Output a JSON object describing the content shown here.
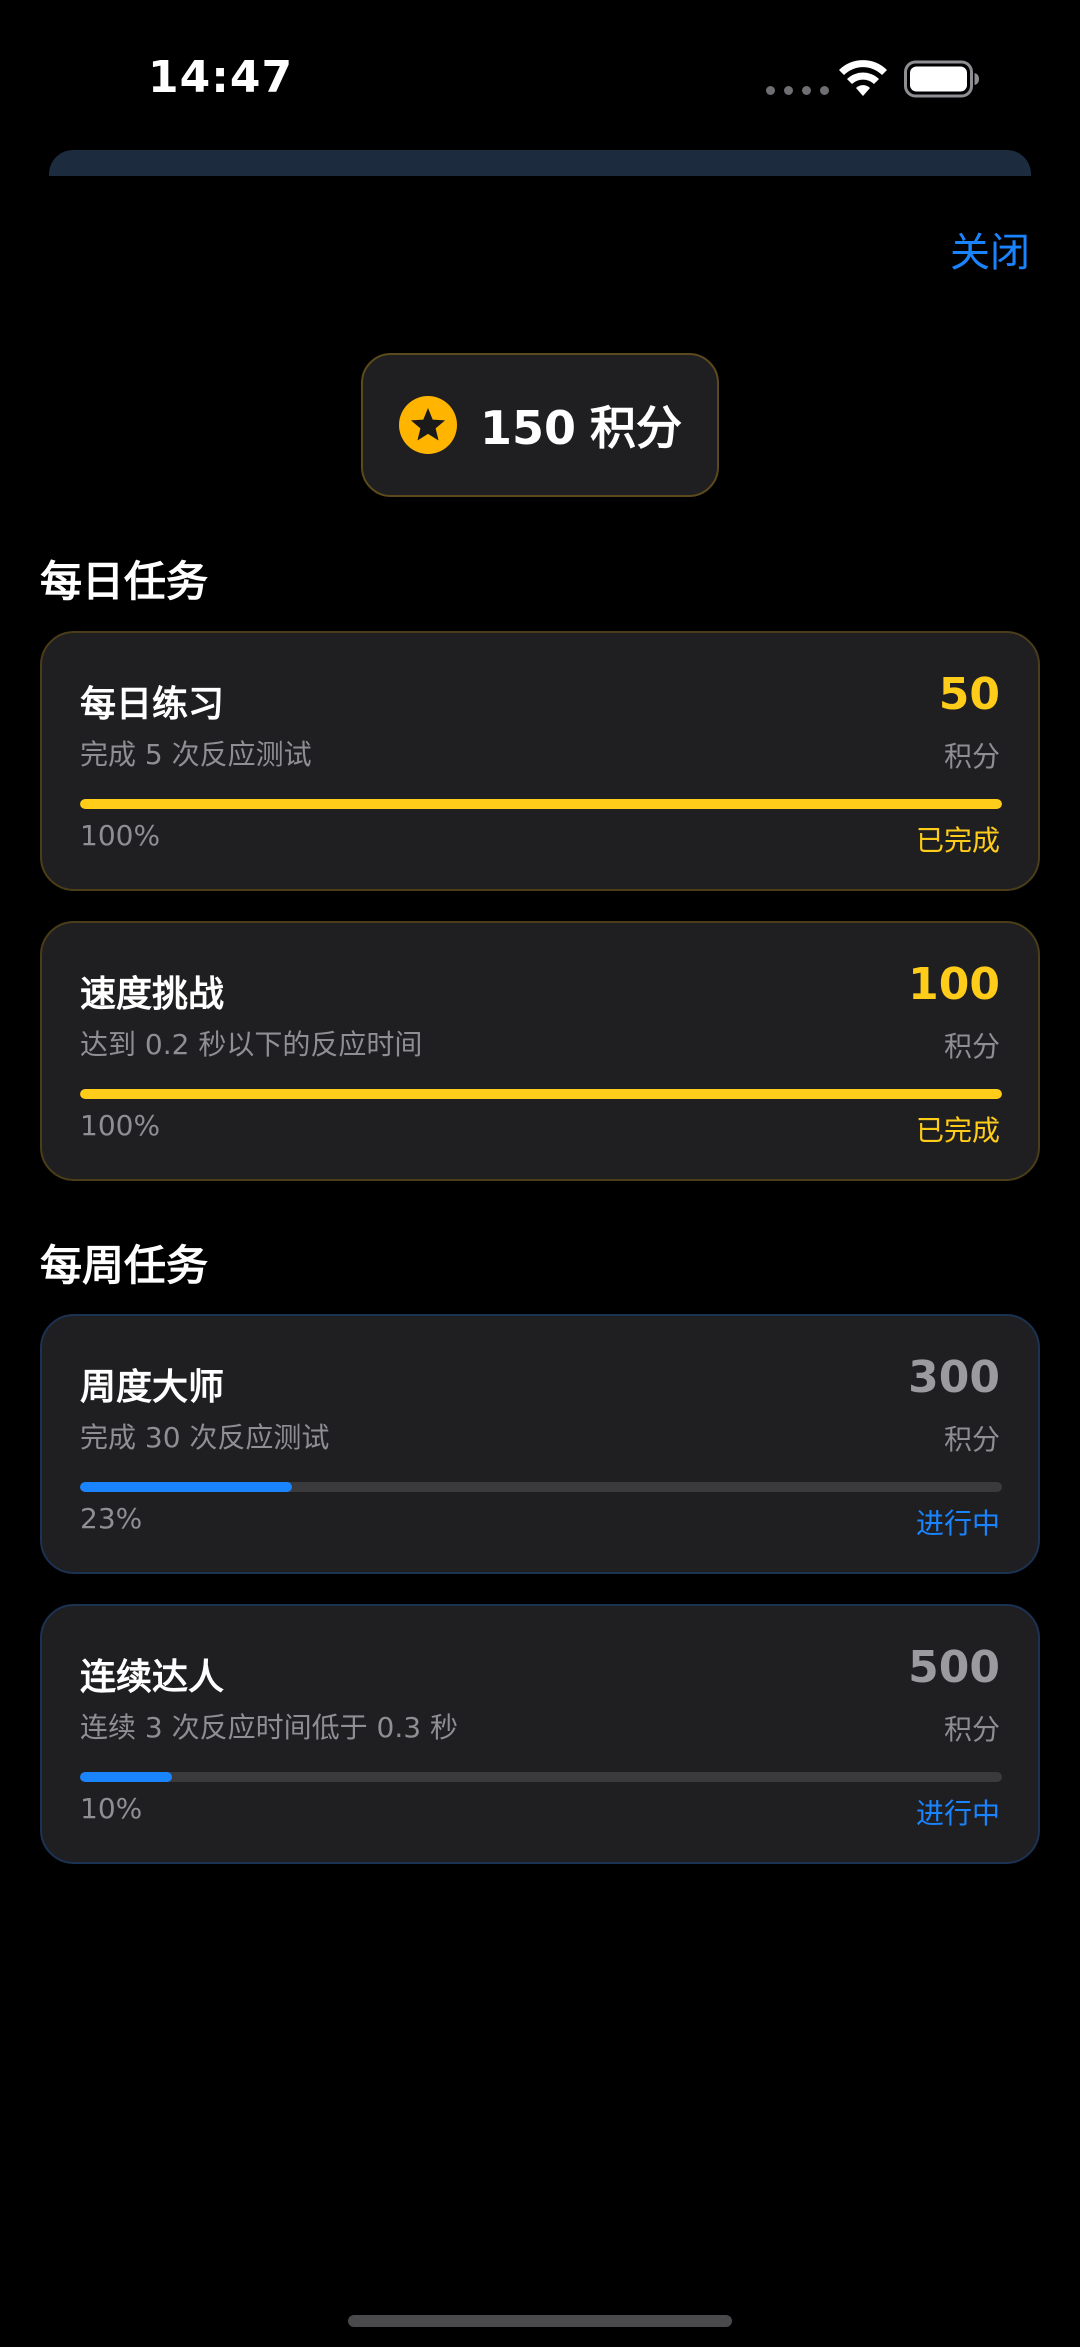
{
  "status_bar": {
    "time": "14:47"
  },
  "header": {
    "close_label": "关闭"
  },
  "points": {
    "value": "150",
    "unit": "积分"
  },
  "sections": {
    "daily_title": "每日任务",
    "weekly_title": "每周任务"
  },
  "tasks": [
    {
      "title": "每日练习",
      "description": "完成 5 次反应测试",
      "reward": "50",
      "reward_unit": "积分",
      "progress": 1.0,
      "progress_label": "100%",
      "status": "已完成",
      "state": "done"
    },
    {
      "title": "速度挑战",
      "description": "达到 0.2 秒以下的反应时间",
      "reward": "100",
      "reward_unit": "积分",
      "progress": 1.0,
      "progress_label": "100%",
      "status": "已完成",
      "state": "done"
    },
    {
      "title": "周度大师",
      "description": "完成 30 次反应测试",
      "reward": "300",
      "reward_unit": "积分",
      "progress": 0.23,
      "progress_label": "23%",
      "status": "进行中",
      "state": "pending"
    },
    {
      "title": "连续达人",
      "description": "连续 3 次反应时间低于 0.3 秒",
      "reward": "500",
      "reward_unit": "积分",
      "progress": 0.1,
      "progress_label": "10%",
      "status": "进行中",
      "state": "pending"
    }
  ],
  "colors": {
    "accent_blue": "#1a84ff",
    "accent_gold": "#ffcc1a",
    "card_bg": "#1f1f21"
  },
  "icons": {
    "points": "star-icon",
    "wifi": "wifi-icon",
    "battery": "battery-icon"
  }
}
